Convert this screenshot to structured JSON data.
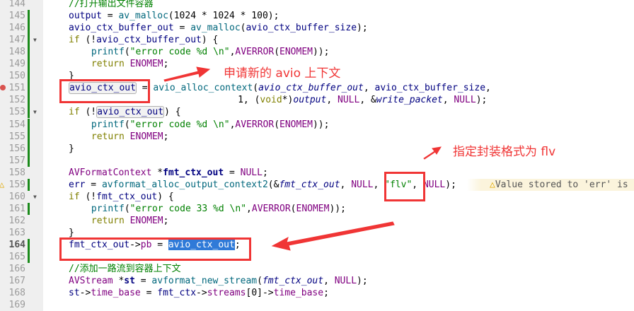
{
  "editor": {
    "current_line": 164,
    "lines": [
      {
        "n": 144,
        "indent": 0,
        "tokens": [
          [
            "//打开输出文件容器",
            "cm"
          ]
        ]
      },
      {
        "n": 145,
        "indent": 0,
        "tokens": [
          [
            "output",
            "id"
          ],
          [
            " = ",
            ""
          ],
          [
            "av_malloc",
            "fn"
          ],
          [
            "(1024 * 1024 * 100);",
            ""
          ]
        ]
      },
      {
        "n": 146,
        "indent": 0,
        "tokens": [
          [
            "avio_ctx_buffer_out",
            "id"
          ],
          [
            " = ",
            ""
          ],
          [
            "av_malloc",
            "fn"
          ],
          [
            "(",
            ""
          ],
          [
            "avio_ctx_buffer_size",
            "id"
          ],
          [
            ");",
            ""
          ]
        ]
      },
      {
        "n": 147,
        "indent": 0,
        "fold": true,
        "tokens": [
          [
            "if",
            "kw"
          ],
          [
            " (!",
            ""
          ],
          [
            "avio_ctx_buffer_out",
            "id"
          ],
          [
            ") {",
            ""
          ]
        ]
      },
      {
        "n": 148,
        "indent": 1,
        "tokens": [
          [
            "printf",
            "fn"
          ],
          [
            "(",
            ""
          ],
          [
            "\"error code %d \\n\"",
            "str"
          ],
          [
            ",",
            ""
          ],
          [
            "AVERROR",
            "mac"
          ],
          [
            "(",
            ""
          ],
          [
            "ENOMEM",
            "mac"
          ],
          [
            "));",
            ""
          ]
        ]
      },
      {
        "n": 149,
        "indent": 1,
        "tokens": [
          [
            "return",
            "kw"
          ],
          [
            " ",
            ""
          ],
          [
            "ENOMEM",
            "mac"
          ],
          [
            ";",
            ""
          ]
        ]
      },
      {
        "n": 150,
        "indent": 0,
        "tokens": [
          [
            "}",
            ""
          ]
        ]
      },
      {
        "n": 151,
        "indent": 0,
        "tokens": [
          [
            "avio_ctx_out",
            "id hl"
          ],
          [
            " = ",
            ""
          ],
          [
            "avio_alloc_context",
            "fn"
          ],
          [
            "(",
            ""
          ],
          [
            "avio_ctx_buffer_out",
            "it"
          ],
          [
            ", ",
            ""
          ],
          [
            "avio_ctx_buffer_size",
            "id"
          ],
          [
            ",",
            ""
          ]
        ]
      },
      {
        "n": 152,
        "indent": 0,
        "pad": 30,
        "tokens": [
          [
            "1, (",
            ""
          ],
          [
            "void",
            "kw"
          ],
          [
            "*)",
            ""
          ],
          [
            "output",
            "it"
          ],
          [
            ", ",
            ""
          ],
          [
            "NULL",
            "mac"
          ],
          [
            ", &",
            ""
          ],
          [
            "write_packet",
            "it"
          ],
          [
            ", ",
            ""
          ],
          [
            "NULL",
            "mac"
          ],
          [
            ");",
            ""
          ]
        ]
      },
      {
        "n": 153,
        "indent": 0,
        "fold": true,
        "tokens": [
          [
            "if",
            "kw"
          ],
          [
            " (!",
            ""
          ],
          [
            "avio_ctx_out",
            "id hl"
          ],
          [
            ") {",
            ""
          ]
        ]
      },
      {
        "n": 154,
        "indent": 1,
        "tokens": [
          [
            "printf",
            "fn"
          ],
          [
            "(",
            ""
          ],
          [
            "\"error code %d \\n\"",
            "str"
          ],
          [
            ",",
            ""
          ],
          [
            "AVERROR",
            "mac"
          ],
          [
            "(",
            ""
          ],
          [
            "ENOMEM",
            "mac"
          ],
          [
            "));",
            ""
          ]
        ]
      },
      {
        "n": 155,
        "indent": 1,
        "tokens": [
          [
            "return",
            "kw"
          ],
          [
            " ",
            ""
          ],
          [
            "ENOMEM",
            "mac"
          ],
          [
            ";",
            ""
          ]
        ]
      },
      {
        "n": 156,
        "indent": 0,
        "tokens": [
          [
            "}",
            ""
          ]
        ]
      },
      {
        "n": 157,
        "indent": 0,
        "tokens": []
      },
      {
        "n": 158,
        "indent": 0,
        "tokens": [
          [
            "AVFormatContext",
            "ty"
          ],
          [
            " *",
            ""
          ],
          [
            "fmt_ctx_out",
            "id b"
          ],
          [
            " = ",
            ""
          ],
          [
            "NULL",
            "mac"
          ],
          [
            ";",
            ""
          ]
        ]
      },
      {
        "n": 159,
        "indent": 0,
        "warn": true,
        "tokens": [
          [
            "err",
            "id"
          ],
          [
            " = ",
            ""
          ],
          [
            "avformat_alloc_output_context2",
            "fn"
          ],
          [
            "(&",
            ""
          ],
          [
            "fmt_ctx_out",
            "it"
          ],
          [
            ", ",
            ""
          ],
          [
            "NULL",
            "mac"
          ],
          [
            ", ",
            ""
          ],
          [
            "\"flv\"",
            "str"
          ],
          [
            ", ",
            ""
          ],
          [
            "NULL",
            "mac"
          ],
          [
            ");",
            ""
          ]
        ]
      },
      {
        "n": 160,
        "indent": 0,
        "fold": true,
        "tokens": [
          [
            "if",
            "kw"
          ],
          [
            " (!",
            ""
          ],
          [
            "fmt_ctx_out",
            "id"
          ],
          [
            ") {",
            ""
          ]
        ]
      },
      {
        "n": 161,
        "indent": 1,
        "tokens": [
          [
            "printf",
            "fn"
          ],
          [
            "(",
            ""
          ],
          [
            "\"error code 33 %d \\n\"",
            "str"
          ],
          [
            ",",
            ""
          ],
          [
            "AVERROR",
            "mac"
          ],
          [
            "(",
            ""
          ],
          [
            "ENOMEM",
            "mac"
          ],
          [
            "));",
            ""
          ]
        ]
      },
      {
        "n": 162,
        "indent": 1,
        "tokens": [
          [
            "return",
            "kw"
          ],
          [
            " ",
            ""
          ],
          [
            "ENOMEM",
            "mac"
          ],
          [
            ";",
            ""
          ]
        ]
      },
      {
        "n": 163,
        "indent": 0,
        "tokens": [
          [
            "}",
            ""
          ]
        ]
      },
      {
        "n": 164,
        "indent": 0,
        "tokens": [
          [
            "fmt_ctx_out",
            "id"
          ],
          [
            "->",
            ""
          ],
          [
            "pb",
            "ty"
          ],
          [
            " = ",
            ""
          ],
          [
            "avio_ctx_out",
            "sel"
          ],
          [
            ";",
            ""
          ]
        ]
      },
      {
        "n": 165,
        "indent": 0,
        "tokens": []
      },
      {
        "n": 166,
        "indent": 0,
        "tokens": [
          [
            "//添加一路流到容器上下文",
            "cm"
          ]
        ]
      },
      {
        "n": 167,
        "indent": 0,
        "tokens": [
          [
            "AVStream",
            "ty"
          ],
          [
            " *",
            ""
          ],
          [
            "st",
            "id b"
          ],
          [
            " = ",
            ""
          ],
          [
            "avformat_new_stream",
            "fn"
          ],
          [
            "(",
            ""
          ],
          [
            "fmt_ctx_out",
            "it"
          ],
          [
            ", ",
            ""
          ],
          [
            "NULL",
            "mac"
          ],
          [
            ");",
            ""
          ]
        ]
      },
      {
        "n": 168,
        "indent": 0,
        "tokens": [
          [
            "st",
            "id"
          ],
          [
            "->",
            ""
          ],
          [
            "time_base",
            "ty"
          ],
          [
            " = ",
            ""
          ],
          [
            "fmt_ctx",
            "id"
          ],
          [
            "->",
            ""
          ],
          [
            "streams",
            "ty"
          ],
          [
            "[0]->",
            ""
          ],
          [
            "time_base",
            "ty"
          ],
          [
            ";",
            ""
          ]
        ]
      },
      {
        "n": 169,
        "indent": 0,
        "tokens": []
      }
    ],
    "changed_lines": [
      145,
      146,
      147,
      148,
      149,
      150,
      151,
      152,
      153,
      154,
      155,
      156,
      157,
      159,
      161,
      164,
      165
    ],
    "warning_text": "Value stored to 'err' is",
    "warning_icon": "warning-triangle-icon",
    "breakpoint_line": 151
  },
  "annotations": {
    "note1": "申请新的 avio 上下文",
    "note2": "指定封装格式为 flv",
    "color": "#f03535"
  }
}
